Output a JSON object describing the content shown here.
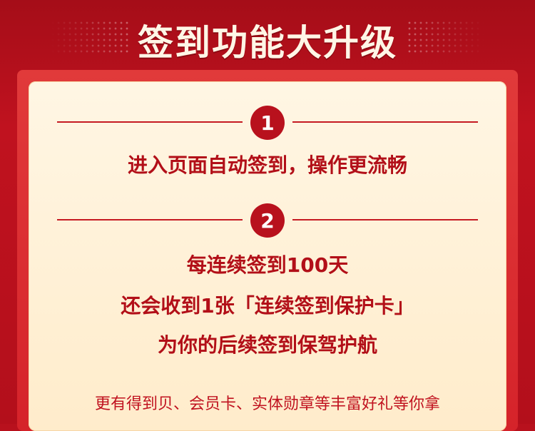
{
  "title": "签到功能大升级",
  "items": [
    {
      "number": "1",
      "lines": [
        "进入页面自动签到，操作更流畅"
      ]
    },
    {
      "number": "2",
      "lines": [
        "每连续签到100天",
        "还会收到1张「连续签到保护卡」",
        "为你的后续签到保驾护航"
      ]
    }
  ],
  "footer": "更有得到贝、会员卡、实体勋章等丰富好礼等你拿"
}
